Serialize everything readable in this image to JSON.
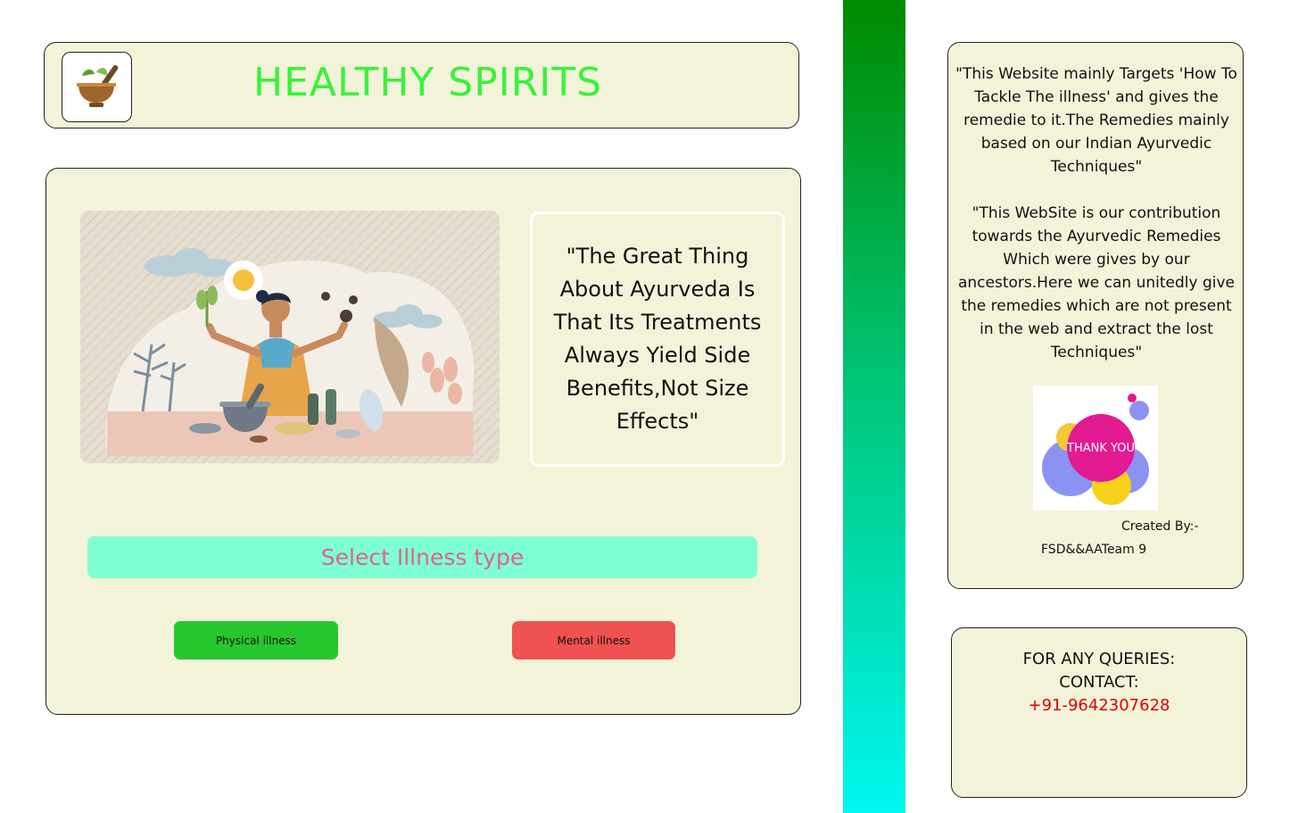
{
  "header": {
    "title": "HEALTHY SPIRITS",
    "logo_icon": "mortar-pestle-herb-icon"
  },
  "main": {
    "hero_image": "ayurveda-woman-herbs-illustration",
    "quote": "\"The Great Thing About Ayurveda Is That Its Treatments Always Yield Side Benefits,Not Size Effects\"",
    "select_label": "Select Illness type",
    "buttons": {
      "physical": "Physical illness",
      "mental": "Mental illness"
    }
  },
  "about": {
    "paragraph_1": "\"This Website mainly Targets 'How To Tackle The illness' and gives the remedie to it.The Remedies mainly based on our Indian Ayurvedic Techniques\"",
    "paragraph_2": "\"This WebSite is our contribution towards the Ayurvedic Remedies Which were gives by our ancestors.Here we can unitedly give the remedies which are not present in the web and extract the lost Techniques\"",
    "thank_you": "THANK YOU",
    "created_by": "Created By:-",
    "team": "FSD&&AATeam 9"
  },
  "contact": {
    "line_1": "FOR ANY QUERIES:",
    "line_2": "CONTACT:",
    "phone": "+91-9642307628"
  },
  "colors": {
    "panel_bg": "#f3f3da",
    "title": "#39f23a",
    "select_bar": "#7fffd4",
    "select_text": "#d46a87",
    "physical_button": "#26c72e",
    "mental_button": "#f05151",
    "phone": "#e00000",
    "gradient_top": "#008a00",
    "gradient_bottom": "#00f7ef"
  }
}
